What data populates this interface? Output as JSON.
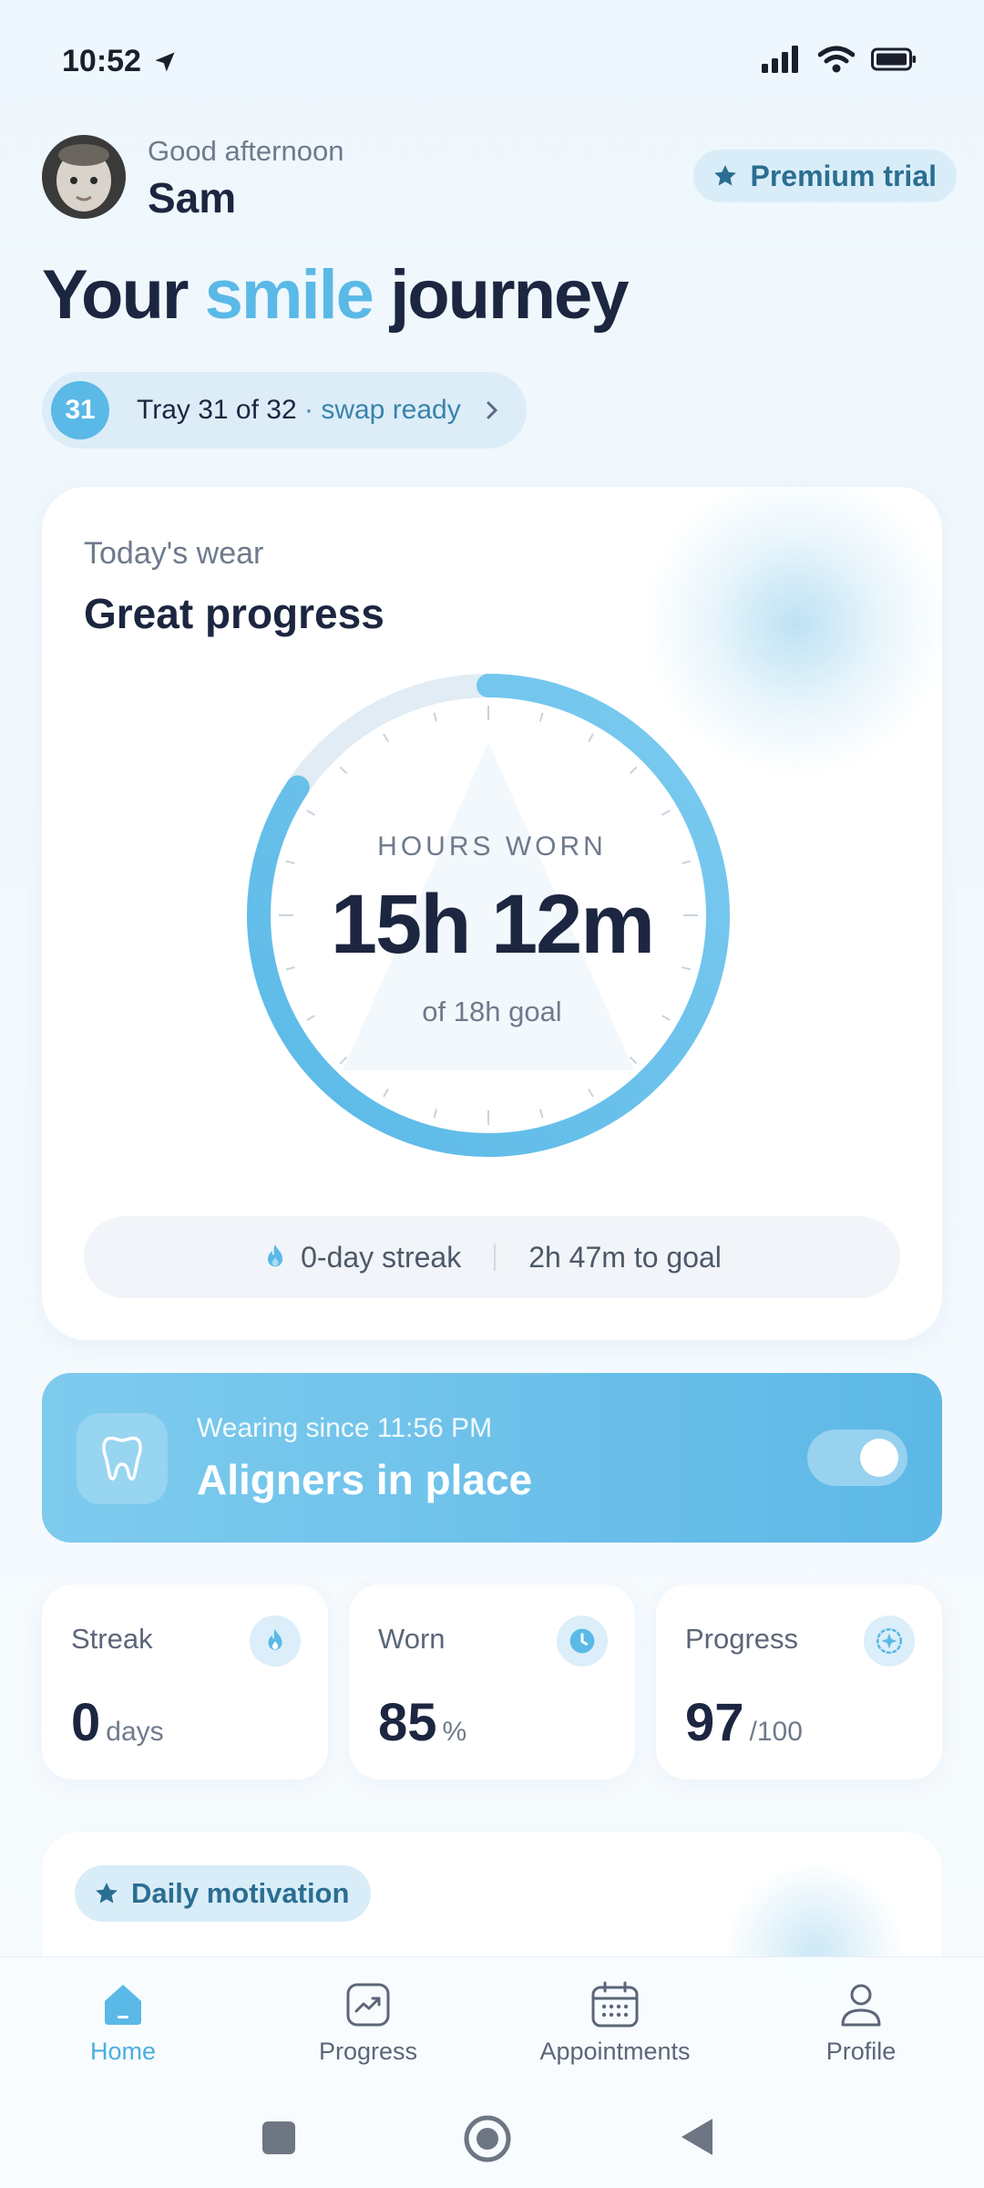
{
  "status_bar": {
    "time": "10:52"
  },
  "header": {
    "greeting": "Good afternoon",
    "name": "Sam",
    "premium_label": "Premium trial",
    "headline_part1": "Your",
    "headline_accent": "smile",
    "headline_part2": "journey"
  },
  "tray": {
    "number": "31",
    "text": "Tray 31 of 32",
    "status": "· swap ready"
  },
  "wear_card": {
    "subtitle": "Today's wear",
    "title": "Great progress",
    "ring_label": "HOURS WORN",
    "hours_worn": "15h 12m",
    "goal_text": "of 18h goal",
    "progress_fraction": 0.844,
    "streak_text": "0-day streak",
    "to_goal_text": "2h 47m to goal"
  },
  "aligners": {
    "subtitle": "Wearing since 11:56 PM",
    "title": "Aligners in place",
    "toggle_on": true
  },
  "metrics": [
    {
      "label": "Streak",
      "value": "0",
      "unit": "days",
      "icon": "flame-icon"
    },
    {
      "label": "Worn",
      "value": "85",
      "unit": "%",
      "icon": "clock-icon"
    },
    {
      "label": "Progress",
      "value": "97",
      "unit": "/100",
      "icon": "sparkle-icon"
    }
  ],
  "motivation": {
    "label": "Daily motivation"
  },
  "nav": {
    "items": [
      {
        "label": "Home",
        "icon": "home-icon",
        "active": true
      },
      {
        "label": "Progress",
        "icon": "chart-icon",
        "active": false
      },
      {
        "label": "Appointments",
        "icon": "calendar-icon",
        "active": false
      },
      {
        "label": "Profile",
        "icon": "user-icon",
        "active": false
      }
    ]
  },
  "colors": {
    "accent": "#5ab9e6",
    "text": "#1c2640",
    "muted": "#6f7a8c"
  }
}
